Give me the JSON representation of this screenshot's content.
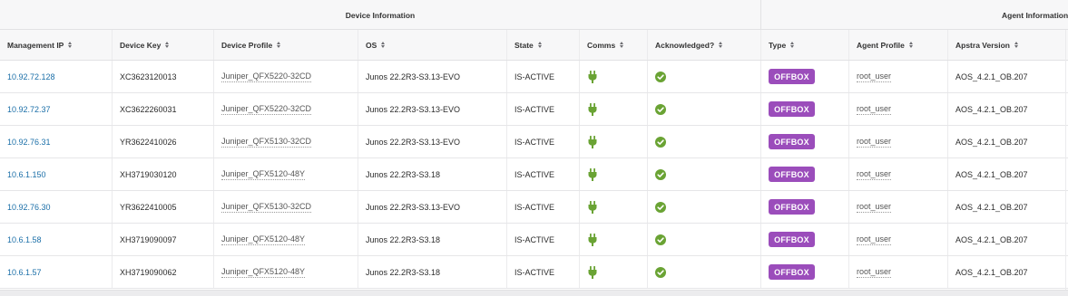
{
  "groups": {
    "device": "Device Information",
    "agent": "Agent Information"
  },
  "columns": {
    "management_ip": "Management IP",
    "device_key": "Device Key",
    "device_profile": "Device Profile",
    "os": "OS",
    "state": "State",
    "comms": "Comms",
    "acknowledged": "Acknowledged?",
    "type": "Type",
    "agent_profile": "Agent Profile",
    "apstra_version": "Apstra Version"
  },
  "colors": {
    "link": "#1b6fa8",
    "badge": "#9b4dbb",
    "status_ok": "#6aa334"
  },
  "icons": {
    "comms": "plug-icon",
    "acknowledged": "check-circle-icon",
    "sort": "sort-icon"
  },
  "rows": [
    {
      "ip": "10.92.72.128",
      "key": "XC3623120013",
      "profile": "Juniper_QFX5220-32CD",
      "os": "Junos 22.2R3-S3.13-EVO",
      "state": "IS-ACTIVE",
      "type": "OFFBOX",
      "agent_profile": "root_user",
      "version": "AOS_4.2.1_OB.207"
    },
    {
      "ip": "10.92.72.37",
      "key": "XC3622260031",
      "profile": "Juniper_QFX5220-32CD",
      "os": "Junos 22.2R3-S3.13-EVO",
      "state": "IS-ACTIVE",
      "type": "OFFBOX",
      "agent_profile": "root_user",
      "version": "AOS_4.2.1_OB.207"
    },
    {
      "ip": "10.92.76.31",
      "key": "YR3622410026",
      "profile": "Juniper_QFX5130-32CD",
      "os": "Junos 22.2R3-S3.13-EVO",
      "state": "IS-ACTIVE",
      "type": "OFFBOX",
      "agent_profile": "root_user",
      "version": "AOS_4.2.1_OB.207"
    },
    {
      "ip": "10.6.1.150",
      "key": "XH3719030120",
      "profile": "Juniper_QFX5120-48Y",
      "os": "Junos 22.2R3-S3.18",
      "state": "IS-ACTIVE",
      "type": "OFFBOX",
      "agent_profile": "root_user",
      "version": "AOS_4.2.1_OB.207"
    },
    {
      "ip": "10.92.76.30",
      "key": "YR3622410005",
      "profile": "Juniper_QFX5130-32CD",
      "os": "Junos 22.2R3-S3.13-EVO",
      "state": "IS-ACTIVE",
      "type": "OFFBOX",
      "agent_profile": "root_user",
      "version": "AOS_4.2.1_OB.207"
    },
    {
      "ip": "10.6.1.58",
      "key": "XH3719090097",
      "profile": "Juniper_QFX5120-48Y",
      "os": "Junos 22.2R3-S3.18",
      "state": "IS-ACTIVE",
      "type": "OFFBOX",
      "agent_profile": "root_user",
      "version": "AOS_4.2.1_OB.207"
    },
    {
      "ip": "10.6.1.57",
      "key": "XH3719090062",
      "profile": "Juniper_QFX5120-48Y",
      "os": "Junos 22.2R3-S3.18",
      "state": "IS-ACTIVE",
      "type": "OFFBOX",
      "agent_profile": "root_user",
      "version": "AOS_4.2.1_OB.207"
    }
  ]
}
